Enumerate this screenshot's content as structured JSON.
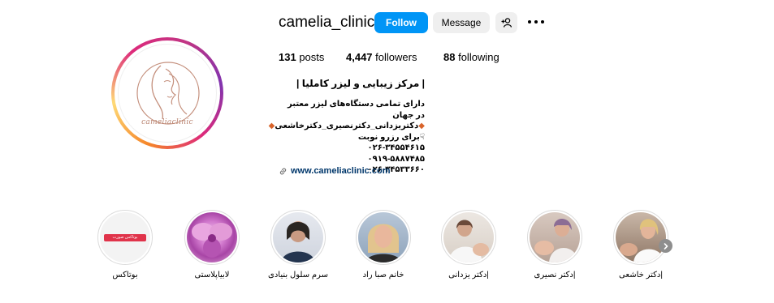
{
  "profile": {
    "username": "camelia_clinic",
    "avatar_logo_text": "cameliaclinic",
    "follow_label": "Follow",
    "message_label": "Message",
    "posts_count": "131",
    "posts_label": "posts",
    "followers_count": "4,447",
    "followers_label": "followers",
    "following_count": "88",
    "following_label": "following"
  },
  "bio": {
    "title": "| مرکز زیبایی و لیزر کاملیا |",
    "line1": "دارای تمامی دستگاه‌های لیزر معتبر در جهان",
    "line2": "دکتریزدانی_دکترنصیری_دکترخاشعی",
    "line3": "برای رزرو نوبت",
    "phone1": "۰۲۶-۳۴۵۵۴۶۱۵",
    "phone2": "۰۹۱۹-۵۸۸۷۴۸۵",
    "phone3": "۰۲۶-۳۴۵۳۳۶۶۰",
    "website": "www.cameliaclinic.com"
  },
  "highlights": [
    {
      "label": "بوتاکس",
      "inner_text": "بوتاکس صورت"
    },
    {
      "label": "لابیاپلاستی"
    },
    {
      "label": "سرم سلول بنیادی"
    },
    {
      "label": "خانم صبا راد"
    },
    {
      "label": "|دکتر یزدانی"
    },
    {
      "label": "|دکتر نصیری"
    },
    {
      "label": "|دکتر خاشعی"
    }
  ],
  "colors": {
    "follow_bg": "#0095f6",
    "secondary_bg": "#efefef",
    "link": "#00376b",
    "accent_orange": "#d9642b"
  },
  "icons": {
    "add_user": "person-plus-icon",
    "more": "three-dots-icon",
    "link": "chain-link-icon",
    "next": "chevron-right-icon"
  }
}
